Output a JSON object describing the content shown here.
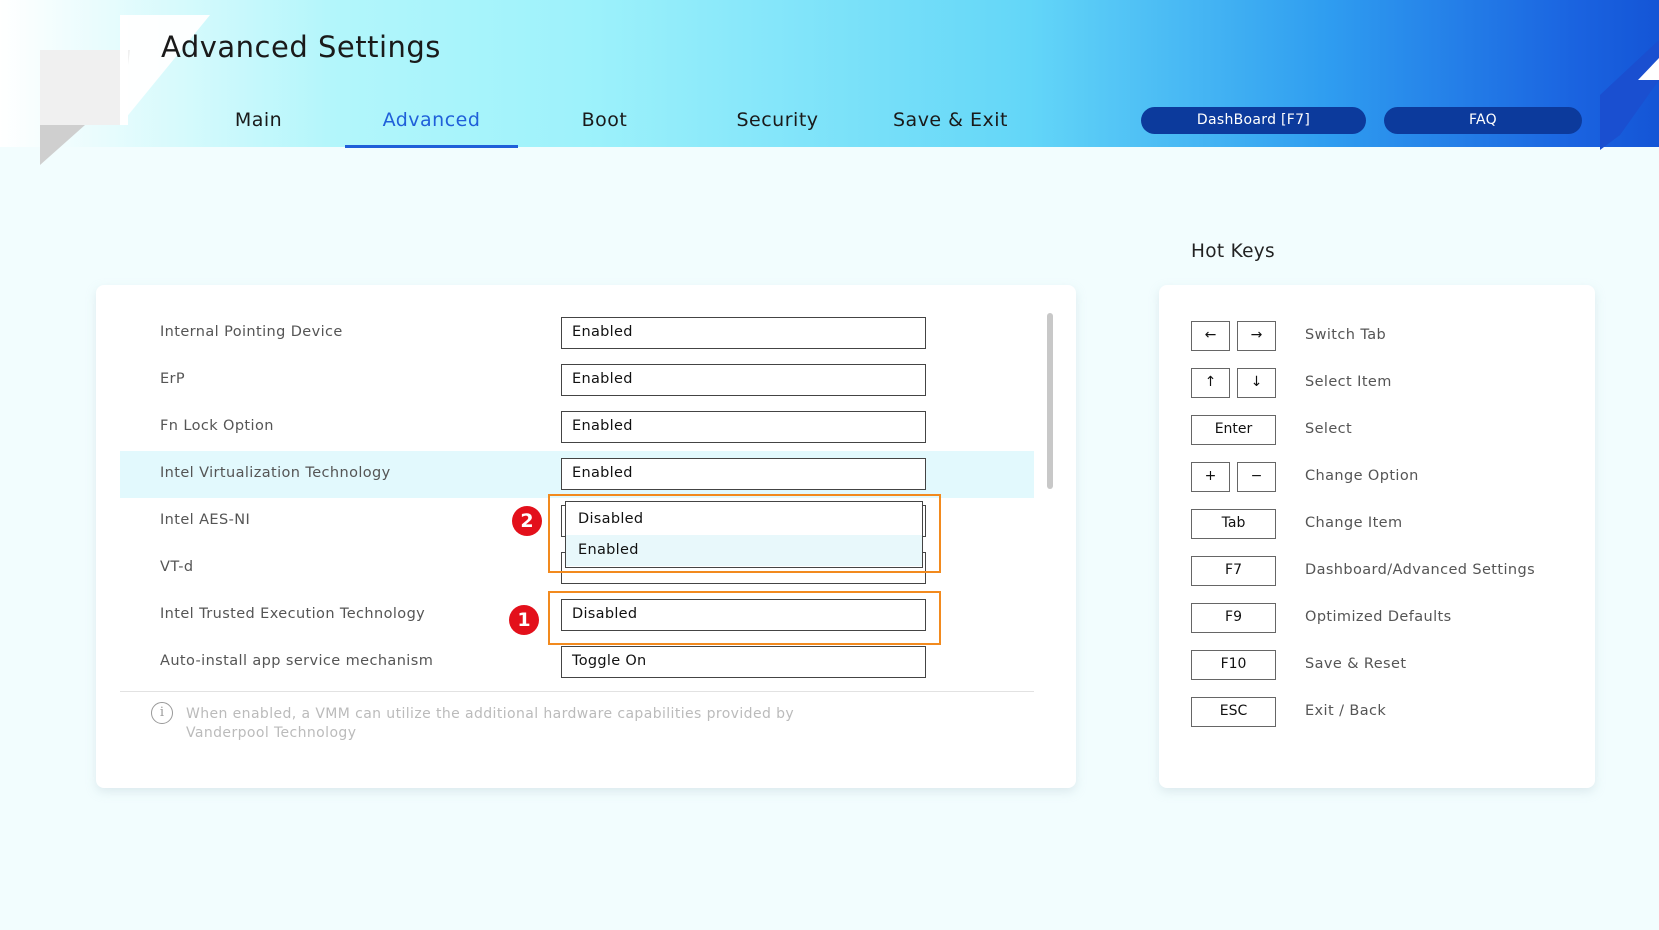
{
  "header": {
    "title": "Advanced Settings",
    "tabs": [
      {
        "label": "Main",
        "active": false
      },
      {
        "label": "Advanced",
        "active": true
      },
      {
        "label": "Boot",
        "active": false
      },
      {
        "label": "Security",
        "active": false
      },
      {
        "label": "Save & Exit",
        "active": false
      }
    ],
    "dashboard_label": "DashBoard [F7]",
    "faq_label": "FAQ",
    "accent_color": "#1f5fd9",
    "pill_color": "#0c3a9c"
  },
  "settings": [
    {
      "label": "Internal Pointing Device",
      "value": "Enabled"
    },
    {
      "label": "ErP",
      "value": "Enabled"
    },
    {
      "label": "Fn Lock Option",
      "value": "Enabled"
    },
    {
      "label": "Intel Virtualization Technology",
      "value": "Enabled"
    },
    {
      "label": "Intel AES-NI",
      "value": ""
    },
    {
      "label": "VT-d",
      "value": ""
    },
    {
      "label": "Intel Trusted Execution Technology",
      "value": "Disabled"
    },
    {
      "label": "Auto-install app service mechanism",
      "value": "Toggle On"
    }
  ],
  "dropdown": {
    "options": [
      "Disabled",
      "Enabled"
    ],
    "selected": "Enabled"
  },
  "annotations": {
    "badge_1": "1",
    "badge_2": "2",
    "box_color": "#f28a1e",
    "badge_color": "#e3101b"
  },
  "info": {
    "line1": "When enabled, a VMM can utilize the additional hardware capabilities provided by",
    "line2": "Vanderpool Technology"
  },
  "hotkeys": {
    "title": "Hot Keys",
    "items": [
      {
        "keys": [
          "←",
          "→"
        ],
        "desc": "Switch Tab"
      },
      {
        "keys": [
          "↑",
          "↓"
        ],
        "desc": "Select Item"
      },
      {
        "keys": [
          "Enter"
        ],
        "desc": "Select"
      },
      {
        "keys": [
          "+",
          "−"
        ],
        "desc": "Change Option"
      },
      {
        "keys": [
          "Tab"
        ],
        "desc": "Change Item"
      },
      {
        "keys": [
          "F7"
        ],
        "desc": "Dashboard/Advanced Settings"
      },
      {
        "keys": [
          "F9"
        ],
        "desc": "Optimized Defaults"
      },
      {
        "keys": [
          "F10"
        ],
        "desc": "Save & Reset"
      },
      {
        "keys": [
          "ESC"
        ],
        "desc": "Exit / Back"
      }
    ]
  }
}
